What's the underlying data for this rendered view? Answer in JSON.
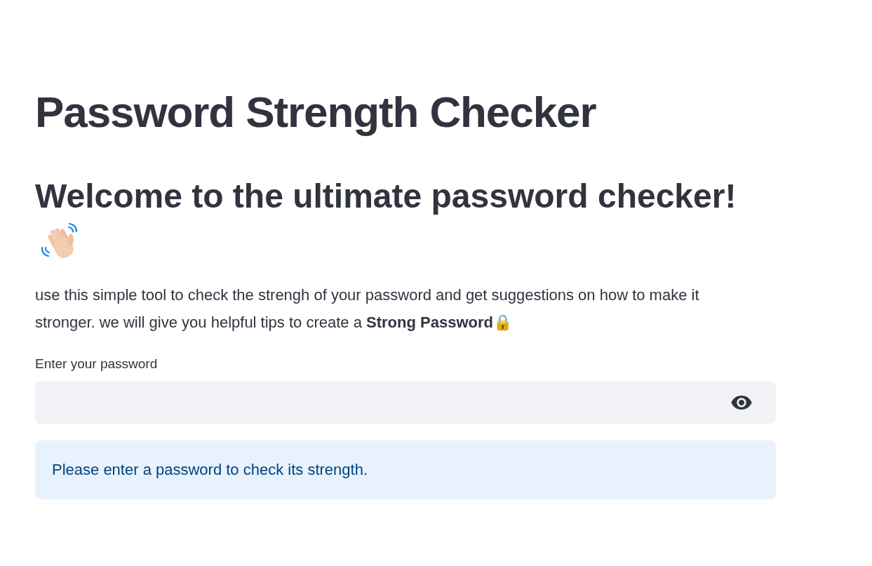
{
  "page": {
    "title": "Password Strength Checker",
    "subtitle": "Welcome to the ultimate password checker!",
    "intro": "use this simple tool to check the strengh of your password and get suggestions on how to make it stronger. we will give you helpful tips to create a **Strong Password**🔒"
  },
  "password_input": {
    "label": "Enter your password"
  },
  "info_message": {
    "text": "Please enter a password to check its strength."
  }
}
